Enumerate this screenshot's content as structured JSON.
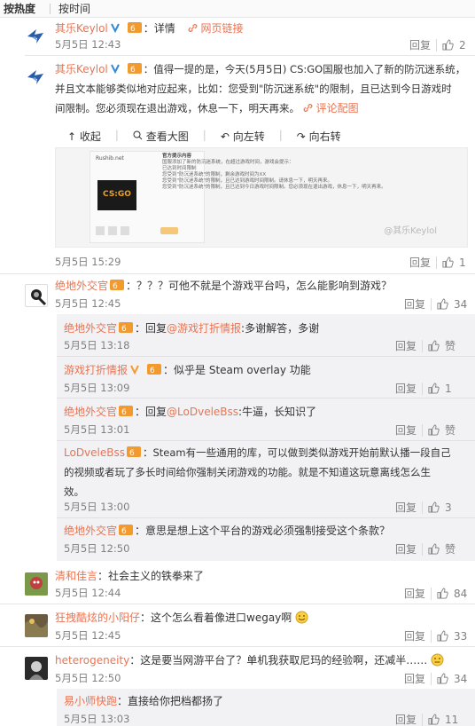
{
  "tabs": [
    "按热度",
    "按时间"
  ],
  "actions": {
    "reply": "回复",
    "like": "赞"
  },
  "post1": {
    "user": "其乐Keylol",
    "text": "：详情",
    "link": "网页链接",
    "time": "5月5日 12:43",
    "likes": "2"
  },
  "post2": {
    "user": "其乐Keylol",
    "text_line1": "：值得一提的是，今天(5月5日) CS:GO国服也加入了新的防沉迷系统，",
    "text_line2": "并且文本能够类似地对应起来，比如：您受到\"防沉迷系统\"的限制，且已达到今日游戏时",
    "text_line3": "间限制。您必须现在退出游戏，休息一下，明天再来。",
    "comment_pic": "评论配图",
    "toolbar": [
      "收起",
      "查看大图",
      "向左转",
      "向右转"
    ],
    "time": "5月5日 15:29",
    "likes": "1",
    "image": {
      "site": "Rushib.net",
      "logo": "CS:GO",
      "title": "官方提示内容",
      "lines": [
        "国服添加了新的防沉迷系统，在超过游戏时间，游戏会提示：",
        "已达到时间限制",
        "您受到\"防沉迷系统\"的限制，剩余游戏时间为XX",
        "您受到\"防沉迷系统\"的限制，且已达到游戏时间限制。请休息一下，明天再来。",
        "您受到\"防沉迷系统\"的限制，且已达到今日游戏时间限制。您必须现在退出游戏，休息一下，明天再来。"
      ],
      "watermark": "@其乐Keylol"
    }
  },
  "post3": {
    "user": "绝地外交官",
    "text": "：？？？可他不就是个游戏平台吗，怎么能影响到游戏？",
    "time": "5月5日 12:45",
    "likes": "34",
    "replies": [
      {
        "user": "绝地外交官",
        "pre": "：回复",
        "mention": "@游戏打折情报",
        "text": ":多谢解答，多谢",
        "time": "5月5日 13:18",
        "likes": "赞"
      },
      {
        "user": "游戏打折情报",
        "pre": "",
        "mention": "",
        "text": "：似乎是 Steam overlay 功能",
        "time": "5月5日 13:09",
        "likes": "1"
      },
      {
        "user": "绝地外交官",
        "pre": "：回复",
        "mention": "@LoDveleBss",
        "text": ":牛逼，长知识了",
        "time": "5月5日 13:01",
        "likes": "赞"
      },
      {
        "user": "LoDveleBss",
        "pre": "",
        "mention": "",
        "text": "：Steam有一些通用的库，可以做到类似游戏开始前默认播一段自己",
        "text2": "的视频或者玩了多长时间给你强制关闭游戏的功能。就是不知道这玩意离线怎么生",
        "text3": "效。",
        "time": "5月5日 13:00",
        "likes": "3"
      },
      {
        "user": "绝地外交官",
        "pre": "",
        "mention": "",
        "text": "：意思是想上这个平台的游戏必须强制接受这个条款？",
        "time": "5月5日 12:50",
        "likes": "赞"
      }
    ]
  },
  "post4": {
    "user": "清和佳言",
    "text": "：社会主义的铁拳来了",
    "time": "5月5日 12:44",
    "likes": "84"
  },
  "post5": {
    "user": "狂拽酷炫的小阳仔",
    "text": "：这个怎么看着像进口wegay啊",
    "time": "5月5日 12:45",
    "likes": "33"
  },
  "post6": {
    "user": "heterogeneity",
    "text": "：这是要当网游平台了？单机我获取尼玛的经验啊，还减半……",
    "time": "5月5日 12:50",
    "likes": "34"
  },
  "post7": {
    "user": "易小师快跑",
    "text": "：直接给你把档都扬了",
    "time": "5月5日 13:03",
    "likes": "11"
  },
  "colors": {
    "link": "#eb7350",
    "user": "#eb7350",
    "bg_sub": "#f2f2f5",
    "meta": "#808080"
  }
}
